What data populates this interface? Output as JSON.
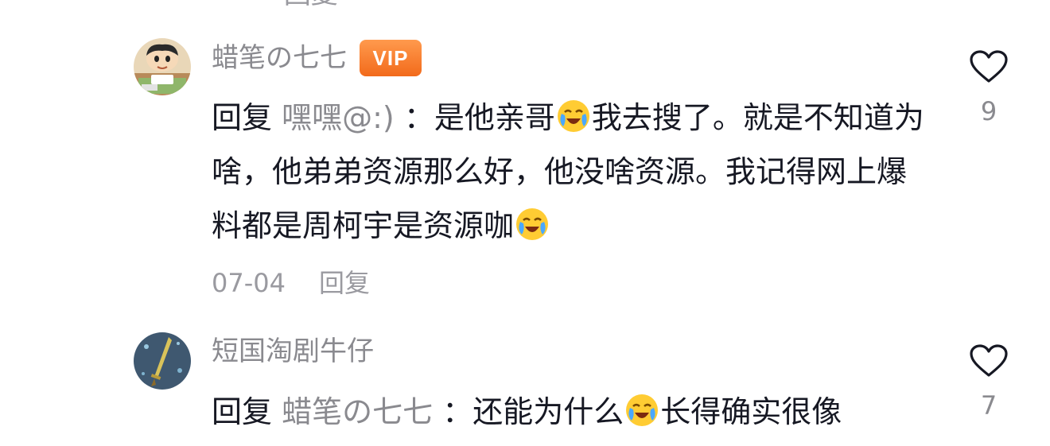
{
  "partial_top": {
    "date": "—",
    "reply": "回复"
  },
  "comments": [
    {
      "username": "蜡笔の七七",
      "vip_badge": "VIP",
      "reply_prefix": "回复",
      "reply_target": "嘿嘿@:)",
      "separator": "：",
      "text_1": "是他亲哥",
      "text_2": "我去搜了。就是不知道为啥，他弟弟资源那么好，他没啥资源。我记得网上爆料都是周柯宇是资源咖",
      "date": "07-04",
      "reply_label": "回复",
      "like_count": "9",
      "avatar_icon": "cartoon-boy-avatar"
    },
    {
      "username": "短国淘剧牛仔",
      "reply_prefix": "回复",
      "reply_target": "蜡笔の七七",
      "separator": "：",
      "text_1": "还能为什么",
      "text_2": "长得确实很像",
      "like_count": "7",
      "avatar_icon": "sword-avatar"
    }
  ],
  "icons": {
    "like": "heart-outline-icon",
    "emoji": "crying-laughing-emoji"
  },
  "colors": {
    "text_primary": "#161823",
    "text_secondary": "#8a8a8f",
    "vip_orange": "#f26a1b"
  }
}
